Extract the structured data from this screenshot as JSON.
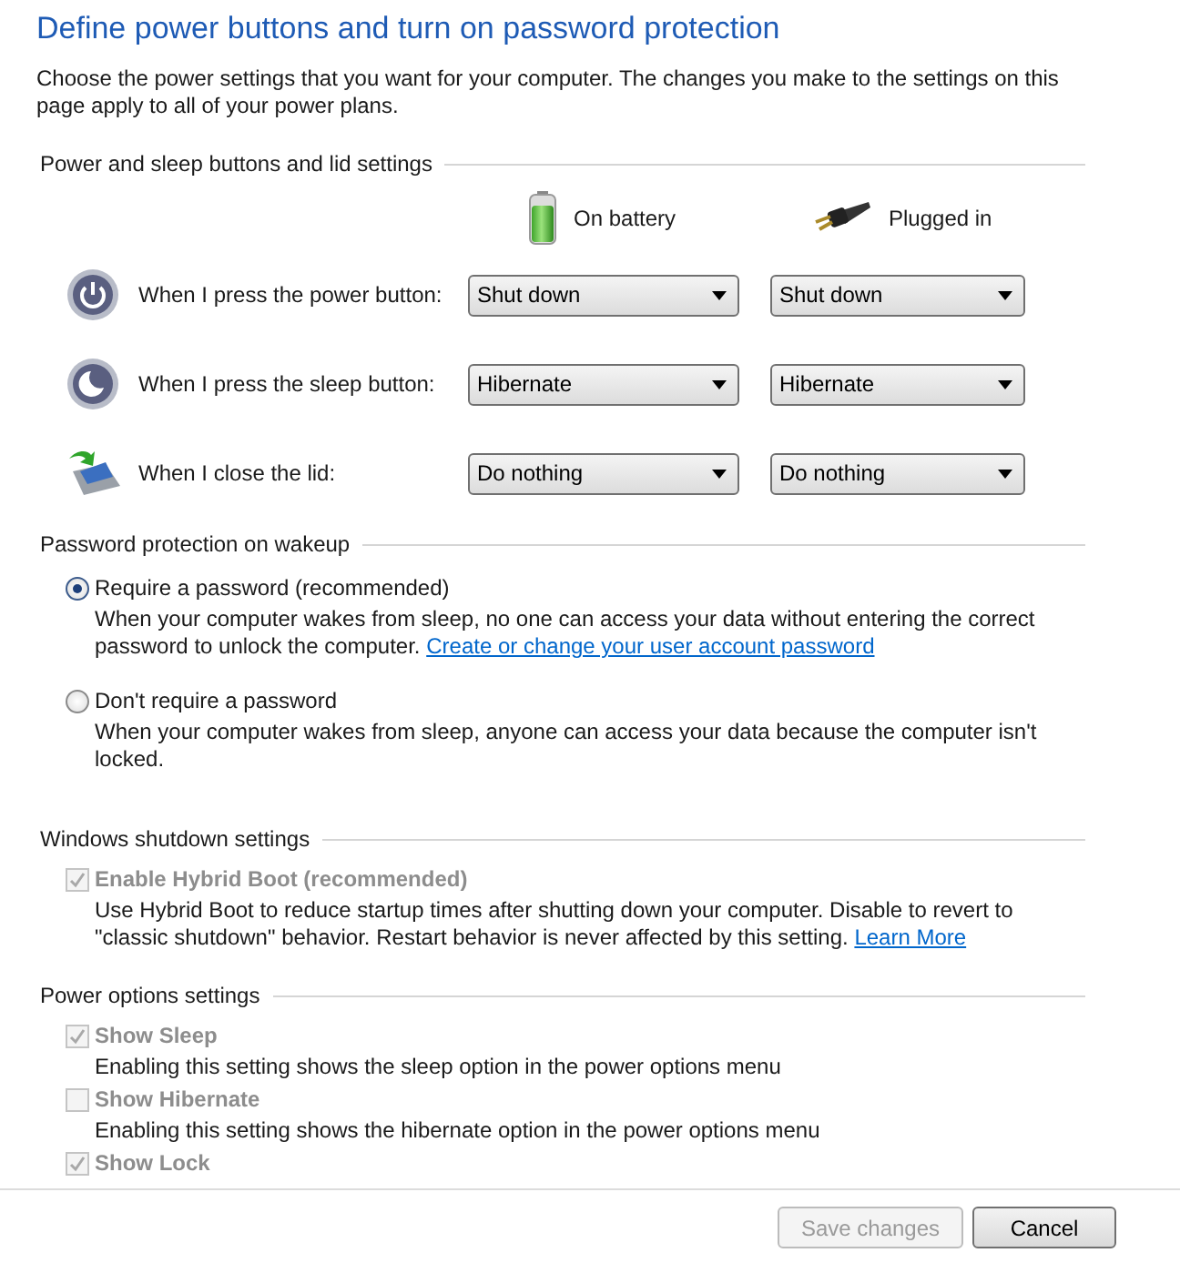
{
  "title": "Define power buttons and turn on password protection",
  "intro": "Choose the power settings that you want for your computer. The changes you make to the settings on this page apply to all of your power plans.",
  "power_section": {
    "heading": "Power and sleep buttons and lid settings",
    "columns": [
      {
        "kind": "battery",
        "label": "On battery"
      },
      {
        "kind": "plug",
        "label": "Plugged in"
      }
    ],
    "rows": [
      {
        "kind": "power",
        "label": "When I press the power button:",
        "values": [
          "Shut down",
          "Shut down"
        ]
      },
      {
        "kind": "sleep",
        "label": "When I press the sleep button:",
        "values": [
          "Hibernate",
          "Hibernate"
        ]
      },
      {
        "kind": "lid",
        "label": "When I close the lid:",
        "values": [
          "Do nothing",
          "Do nothing"
        ]
      }
    ]
  },
  "password_section": {
    "heading": "Password protection on wakeup",
    "options": [
      {
        "label": "Require a password (recommended)",
        "selected": true,
        "description": "When your computer wakes from sleep, no one can access your data without entering the correct password to unlock the computer.",
        "link": "Create or change your user account password"
      },
      {
        "label": "Don't require a password",
        "selected": false,
        "description": "When your computer wakes from sleep, anyone can access your data because the computer isn't locked."
      }
    ]
  },
  "shutdown_section": {
    "heading": "Windows shutdown settings",
    "items": [
      {
        "label": "Enable Hybrid Boot (recommended)",
        "checked": true,
        "disabled": true,
        "description": "Use Hybrid Boot to reduce startup times after shutting down your computer. Disable to revert to \"classic shutdown\" behavior. Restart behavior is never affected by this setting.",
        "link": "Learn More"
      }
    ]
  },
  "options_section": {
    "heading": "Power options settings",
    "items": [
      {
        "label": "Show Sleep",
        "checked": true,
        "disabled": true,
        "description": "Enabling this setting shows the sleep option in the power options menu"
      },
      {
        "label": "Show Hibernate",
        "checked": false,
        "disabled": true,
        "description": "Enabling this setting shows the hibernate option in the power options menu"
      },
      {
        "label": "Show Lock",
        "checked": true,
        "disabled": true
      }
    ]
  },
  "buttons": [
    {
      "label": "Save changes",
      "disabled": true
    },
    {
      "label": "Cancel",
      "disabled": false
    }
  ]
}
